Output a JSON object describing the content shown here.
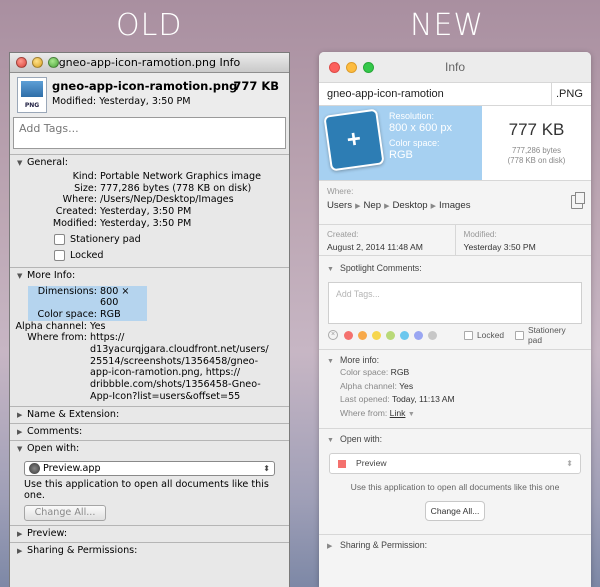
{
  "labels": {
    "old": "OLD",
    "new": "NEW"
  },
  "old": {
    "title": "gneo-app-icon-ramotion.png Info",
    "file_icon_tag": "PNG",
    "file_name": "gneo-app-icon-ramotion.png",
    "file_size": "777 KB",
    "modified": "Modified: Yesterday, 3:50 PM",
    "tags_placeholder": "Add Tags...",
    "general": {
      "header": "General:",
      "rows": [
        {
          "k": "Kind:",
          "v": "Portable Network Graphics image"
        },
        {
          "k": "Size:",
          "v": "777,286 bytes (778 KB on disk)"
        },
        {
          "k": "Where:",
          "v": "/Users/Nep/Desktop/Images"
        },
        {
          "k": "Created:",
          "v": "Yesterday, 3:50 PM"
        },
        {
          "k": "Modified:",
          "v": "Yesterday, 3:50 PM"
        }
      ],
      "stationery": "Stationery pad",
      "locked": "Locked"
    },
    "more_info": {
      "header": "More Info:",
      "dimensions_k": "Dimensions:",
      "dimensions_v": "800 × 600",
      "colorspace_k": "Color space:",
      "colorspace_v": "RGB",
      "alpha_k": "Alpha channel:",
      "alpha_v": "Yes",
      "wherefrom_k": "Where from:",
      "wherefrom_lines": [
        "https://",
        "d13yacurqjgara.cloudfront.net/users/",
        "25514/screenshots/1356458/gneo-",
        "app-icon-ramotion.png, https://",
        "dribbble.com/shots/1356458-Gneo-",
        "App-Icon?list=users&offset=55"
      ]
    },
    "name_ext": "Name & Extension:",
    "comments": "Comments:",
    "open_with": {
      "header": "Open with:",
      "app": "Preview.app",
      "note_line1": "Use this application to open all documents like this",
      "note_line2": "one.",
      "change_all": "Change All..."
    },
    "preview": "Preview:",
    "sharing": "Sharing & Permissions:"
  },
  "new": {
    "title": "Info",
    "file_name": "gneo-app-icon-ramotion",
    "ext": ".PNG",
    "preview": {
      "resolution_lbl": "Resolution:",
      "resolution_val": "800 x 600 px",
      "colorspace_lbl": "Color space:",
      "colorspace_val": "RGB",
      "size_big": "777 KB",
      "size_bytes": "777,286 bytes",
      "size_disk": "(778 KB on disk)"
    },
    "where_lbl": "Where:",
    "path": [
      "Users",
      "Nep",
      "Desktop",
      "Images"
    ],
    "created_lbl": "Created:",
    "created_val": "August 2, 2014 11:48 AM",
    "modified_lbl": "Modified:",
    "modified_val": "Yesterday 3:50 PM",
    "spotlight": "Spotlight Comments:",
    "tags_placeholder": "Add Tags...",
    "tag_colors": [
      "#f4716e",
      "#f7a94a",
      "#f6d64d",
      "#b9d978",
      "#6cc7ee",
      "#9aa6f2",
      "#c7c7c7"
    ],
    "locked": "Locked",
    "stationery": "Stationery pad",
    "more_info": {
      "header": "More info:",
      "colorspace_k": "Color space:",
      "colorspace_v": "RGB",
      "alpha_k": "Alpha channel:",
      "alpha_v": "Yes",
      "lastopened_k": "Last opened:",
      "lastopened_v": "Today, 11:13 AM",
      "wherefrom_k": "Where from:",
      "wherefrom_v": "Link"
    },
    "open_with": {
      "header": "Open with:",
      "app": "Preview",
      "note": "Use this application to open all documents like this one",
      "change_all": "Change All..."
    },
    "sharing": "Sharing & Permission:"
  }
}
